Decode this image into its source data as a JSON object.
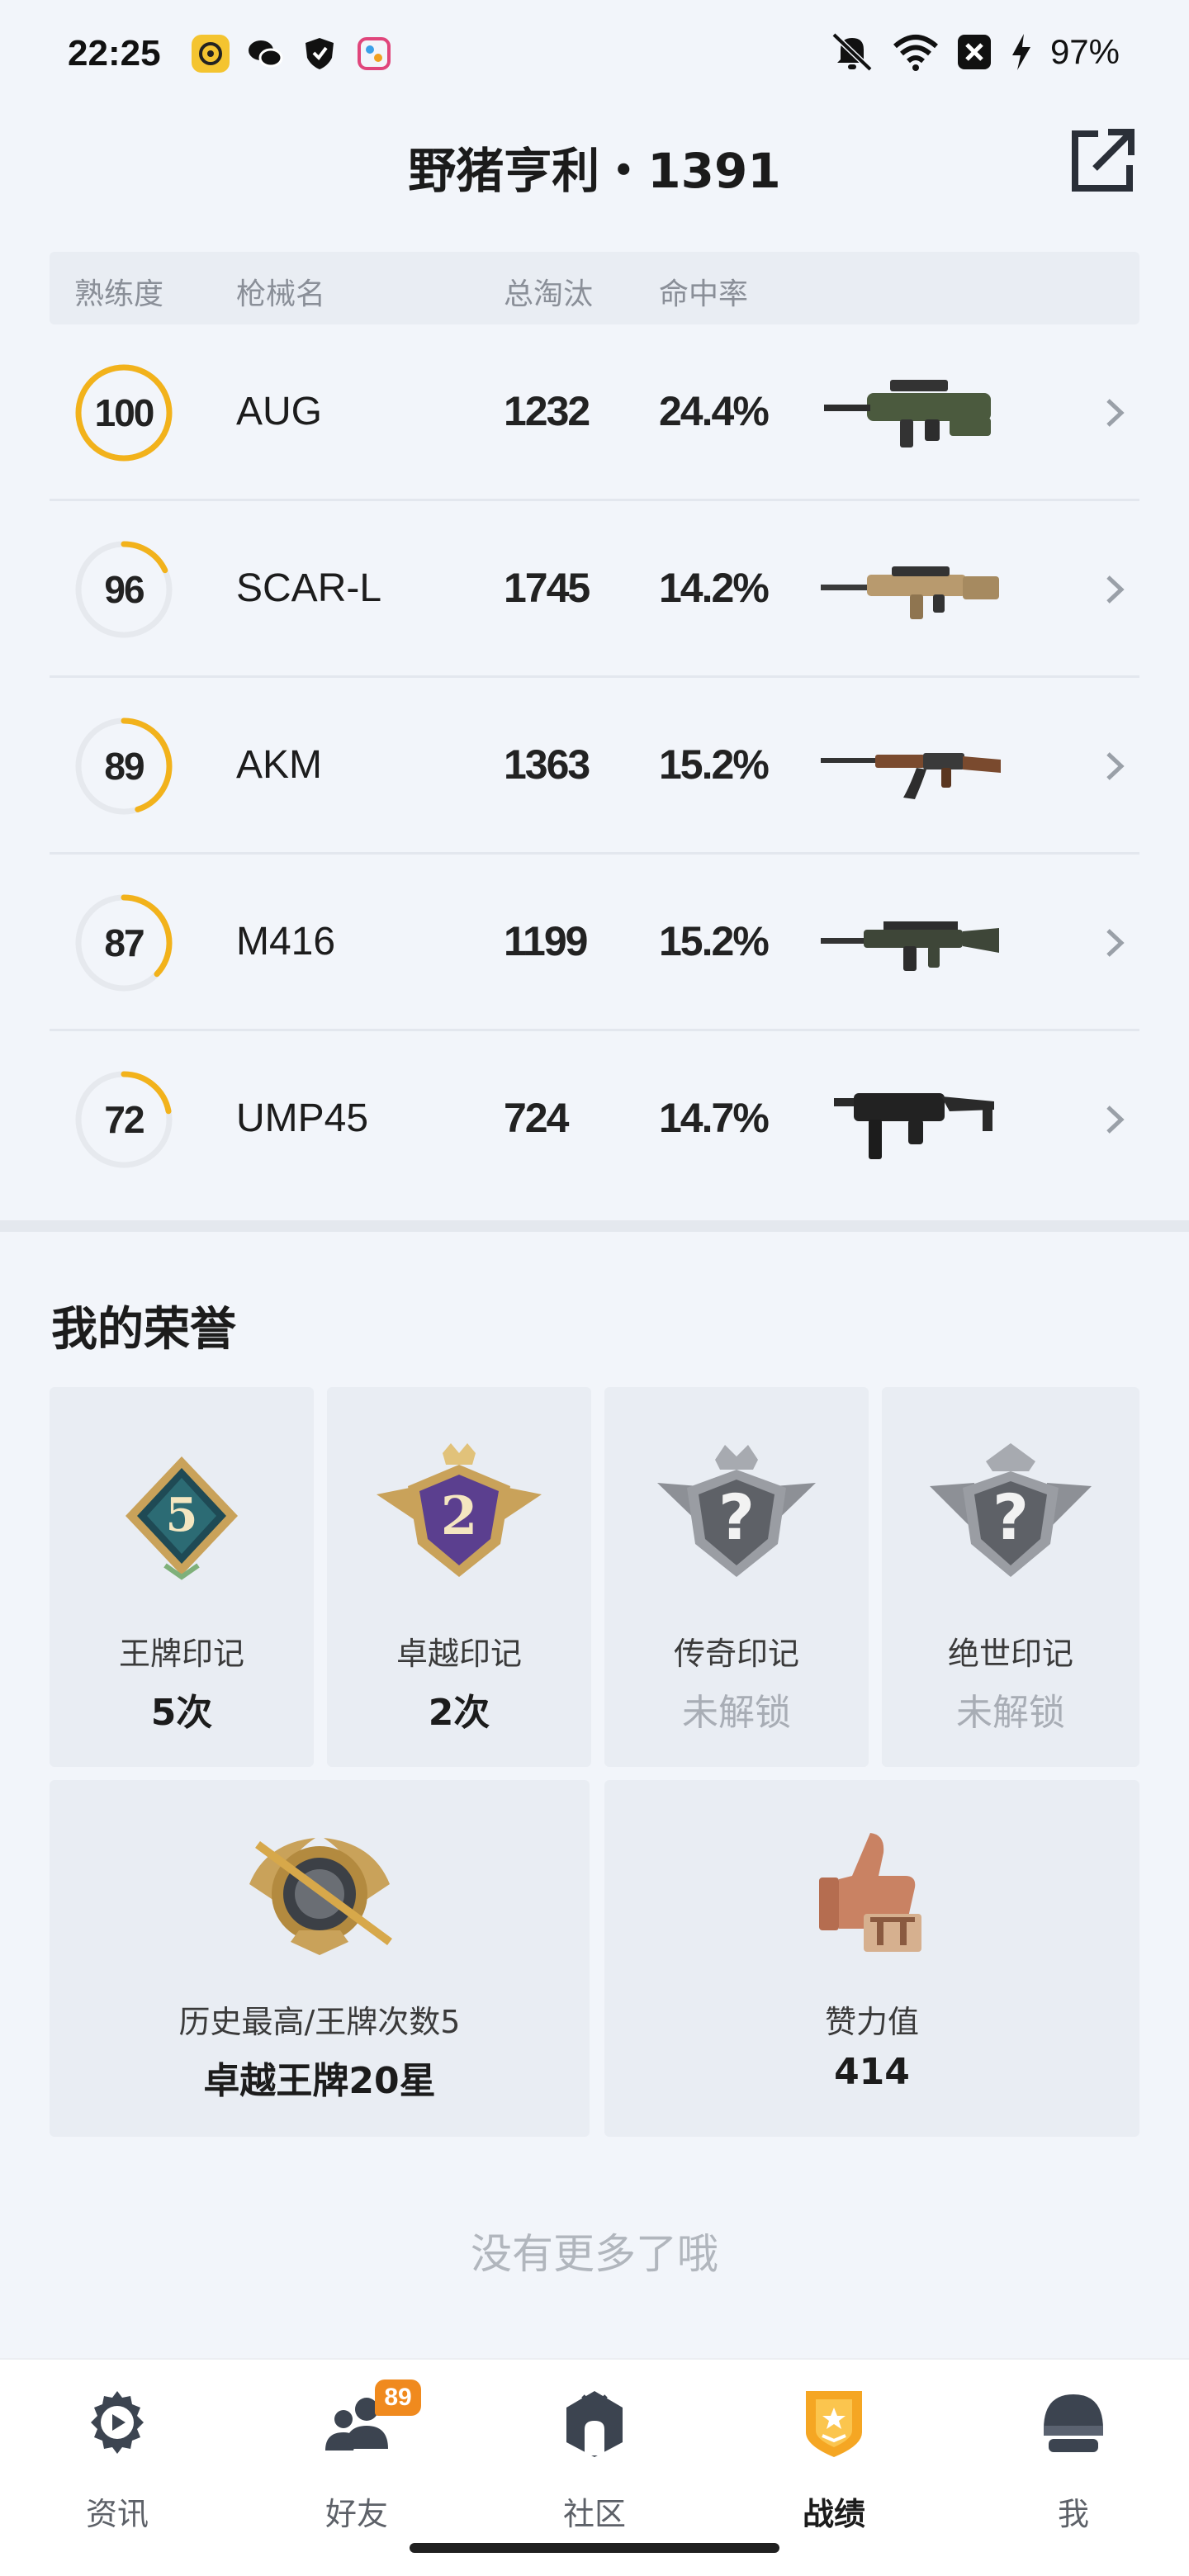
{
  "status_bar": {
    "time": "22:25",
    "battery": "97%"
  },
  "header": {
    "title": "野猪亨利・1391"
  },
  "table": {
    "columns": [
      "熟练度",
      "枪械名",
      "总淘汰",
      "命中率"
    ],
    "rows": [
      {
        "proficiency": "100",
        "level": 1.0,
        "name": "AUG",
        "kills": "1232",
        "hit_rate": "24.4%"
      },
      {
        "proficiency": "96",
        "level": 0.18,
        "name": "SCAR-L",
        "kills": "1745",
        "hit_rate": "14.2%"
      },
      {
        "proficiency": "89",
        "level": 0.45,
        "name": "AKM",
        "kills": "1363",
        "hit_rate": "15.2%"
      },
      {
        "proficiency": "87",
        "level": 0.37,
        "name": "M416",
        "kills": "1199",
        "hit_rate": "15.2%"
      },
      {
        "proficiency": "72",
        "level": 0.22,
        "name": "UMP45",
        "kills": "724",
        "hit_rate": "14.7%"
      }
    ]
  },
  "honors": {
    "title": "我的荣誉",
    "cards": [
      {
        "label": "王牌印记",
        "value": "5次",
        "locked": false
      },
      {
        "label": "卓越印记",
        "value": "2次",
        "locked": false
      },
      {
        "label": "传奇印记",
        "value": "未解锁",
        "locked": true
      },
      {
        "label": "绝世印记",
        "value": "未解锁",
        "locked": true
      }
    ],
    "history": {
      "label": "历史最高/王牌次数5",
      "value": "卓越王牌20星"
    },
    "likes": {
      "label": "赞力值",
      "value": "414"
    },
    "badge_digits": {
      "ace": "5",
      "elite": "2"
    }
  },
  "footer": {
    "no_more": "没有更多了哦"
  },
  "nav": {
    "items": [
      {
        "label": "资讯"
      },
      {
        "label": "好友",
        "badge": "89"
      },
      {
        "label": "社区"
      },
      {
        "label": "战绩"
      },
      {
        "label": "我"
      }
    ]
  },
  "colors": {
    "accent": "#f2b21b",
    "ring_track": "#e6e9ee",
    "nav_active": "#f5a623"
  }
}
